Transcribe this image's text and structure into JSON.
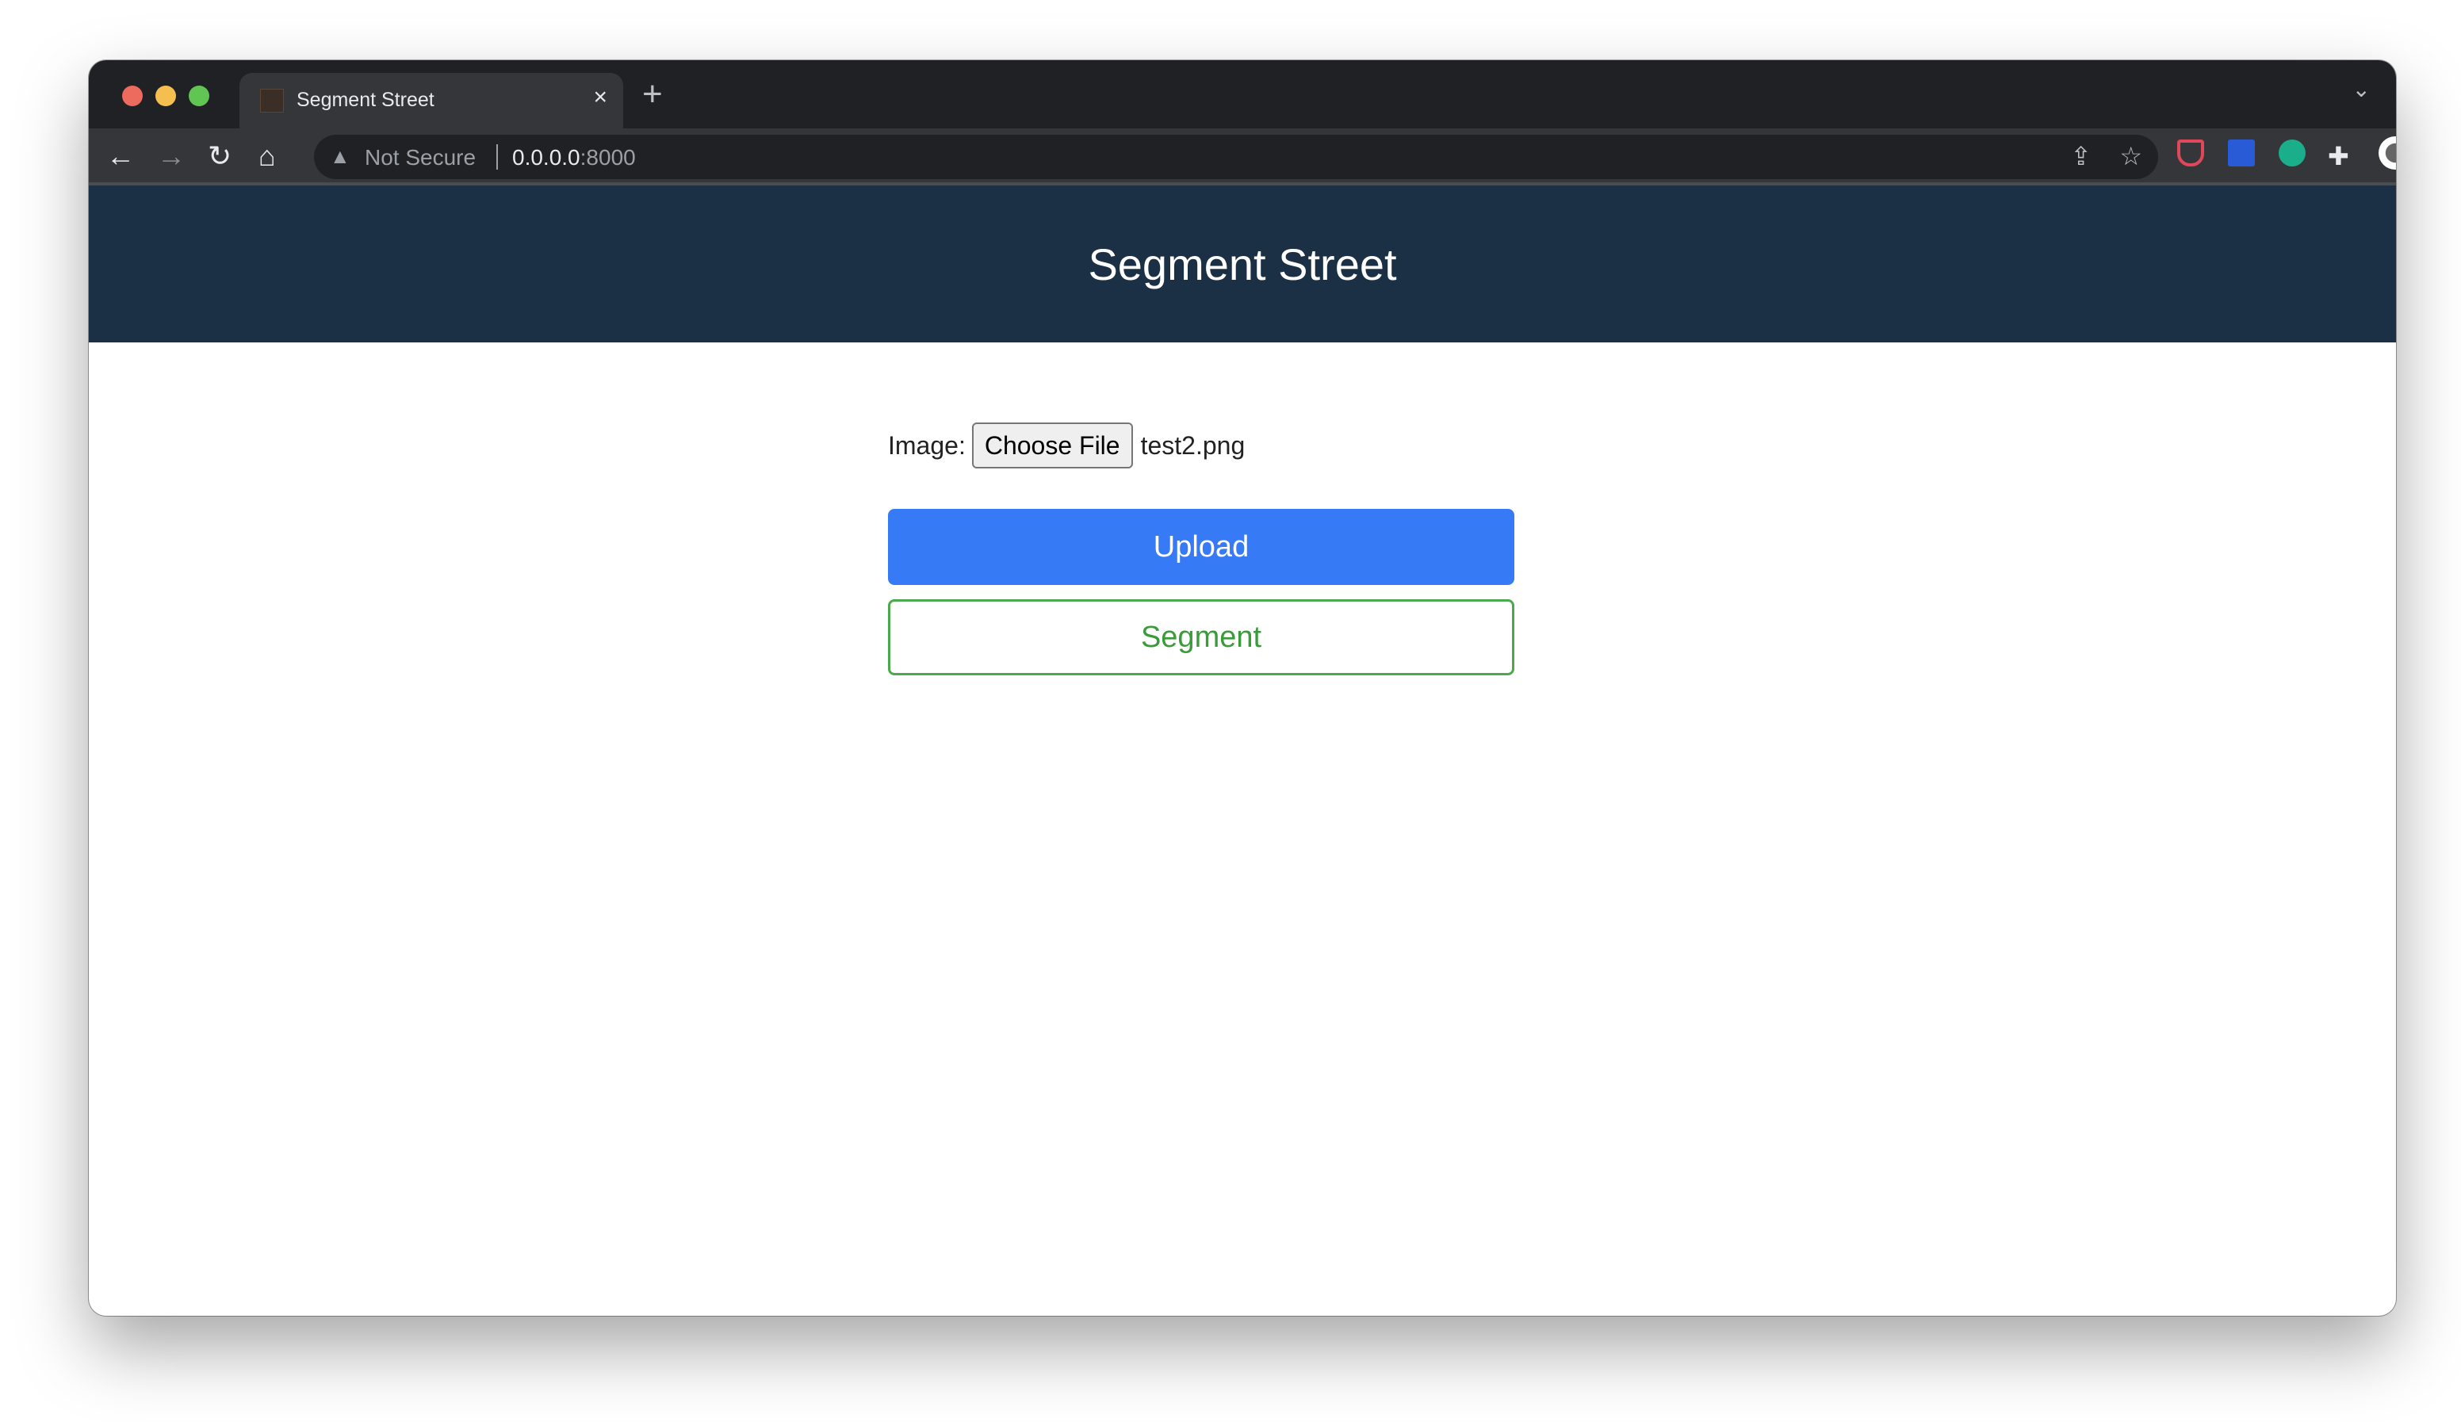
{
  "browser": {
    "tab_title": "Segment Street",
    "tab_close": "×",
    "new_tab": "+",
    "security_label": "Not Secure",
    "url_host": "0.0.0.0",
    "url_port": ":8000"
  },
  "page": {
    "title": "Segment Street",
    "image_label": "Image:",
    "choose_file_label": "Choose File",
    "file_name": "test2.png",
    "upload_label": "Upload",
    "segment_label": "Segment"
  },
  "colors": {
    "header": "#1b2f45",
    "upload": "#377af5",
    "segment": "#3a9b3a"
  }
}
